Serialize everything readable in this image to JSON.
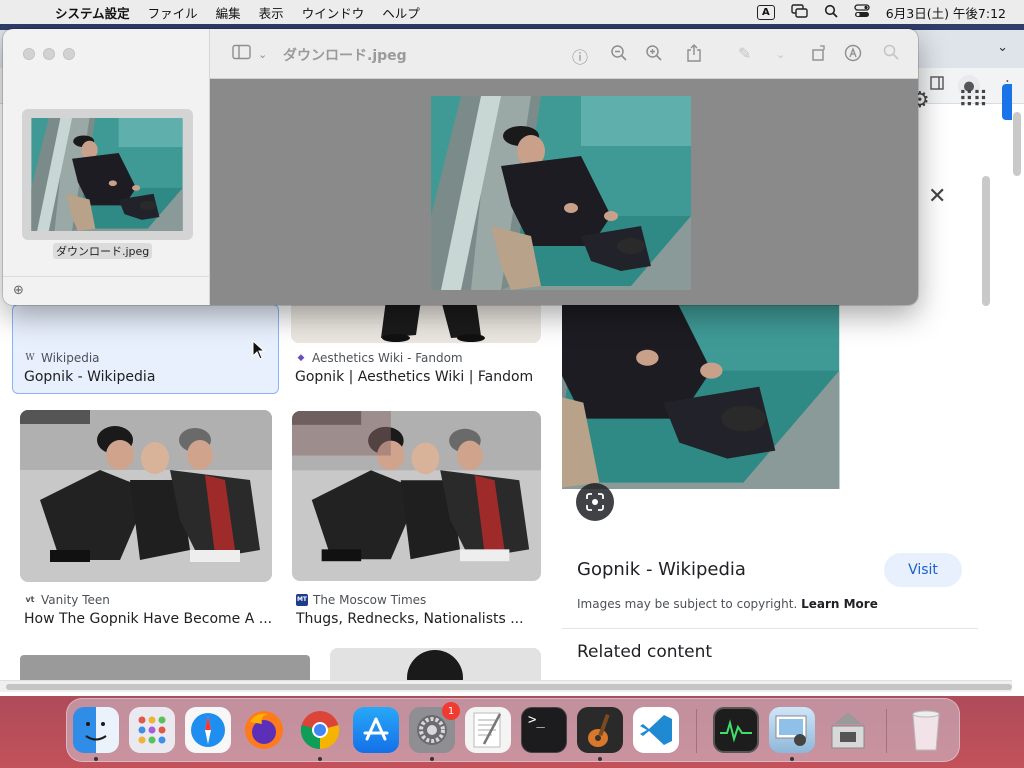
{
  "menubar": {
    "app": "システム設定",
    "items": [
      "ファイル",
      "編集",
      "表示",
      "ウインドウ",
      "ヘルプ"
    ],
    "input_mode": "A",
    "datetime": "6月3日(土) 午後7:12"
  },
  "preview": {
    "filename": "ダウンロード.jpeg",
    "thumbnail_label": "ダウンロード.jpeg"
  },
  "results": [
    {
      "source": "Wikipedia",
      "favicon": "W",
      "title": "Gopnik - Wikipedia"
    },
    {
      "source": "Aesthetics Wiki - Fandom",
      "favicon": "◆",
      "title": "Gopnik | Aesthetics Wiki | Fandom"
    },
    {
      "source": "Vanity Teen",
      "favicon": "vt",
      "title": "How The Gopnik Have Become A ..."
    },
    {
      "source": "The Moscow Times",
      "favicon": "MT",
      "title": "Thugs, Rednecks, Nationalists ..."
    }
  ],
  "panel": {
    "title": "Gopnik - Wikipedia",
    "visit_label": "Visit",
    "copyright_text": "Images may be subject to copyright.",
    "learn_more": "Learn More",
    "related_heading": "Related content"
  },
  "dock": {
    "settings_badge": "1"
  }
}
